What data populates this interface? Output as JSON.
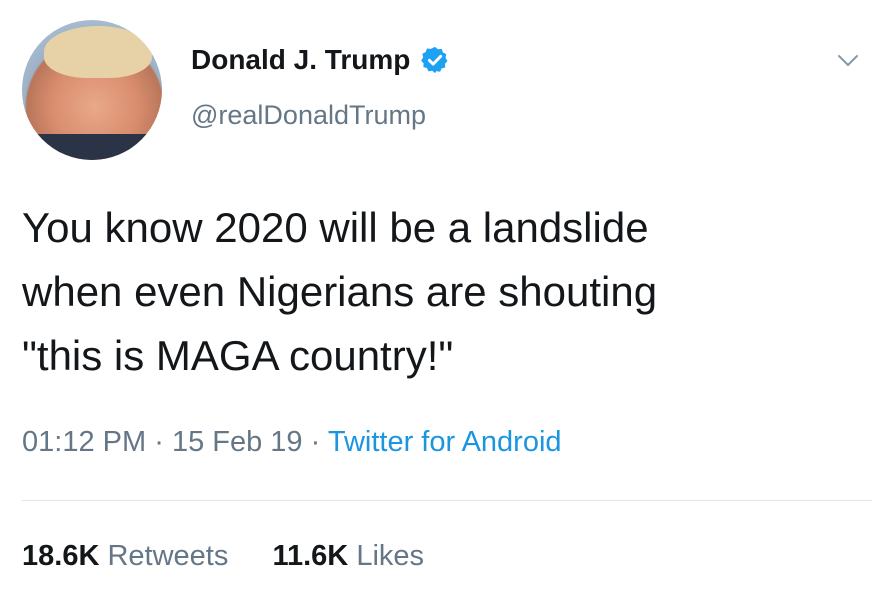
{
  "user": {
    "display_name": "Donald J. Trump",
    "handle": "@realDonaldTrump",
    "verified": true
  },
  "tweet": {
    "lines": [
      "You know 2020 will be a landslide",
      "when even Nigerians are shouting",
      "\"this is MAGA country!\""
    ],
    "time": "01:12 PM",
    "date": "15 Feb 19",
    "source": "Twitter for Android",
    "separator": "·"
  },
  "stats": {
    "retweets_count": "18.6K",
    "retweets_label": "Retweets",
    "likes_count": "11.6K",
    "likes_label": "Likes"
  },
  "icons": {
    "verified": "verified-badge-icon",
    "caret": "chevron-down-icon"
  },
  "colors": {
    "text": "#14171a",
    "secondary": "#657786",
    "link": "#1b95e0",
    "verified": "#1da1f2"
  }
}
